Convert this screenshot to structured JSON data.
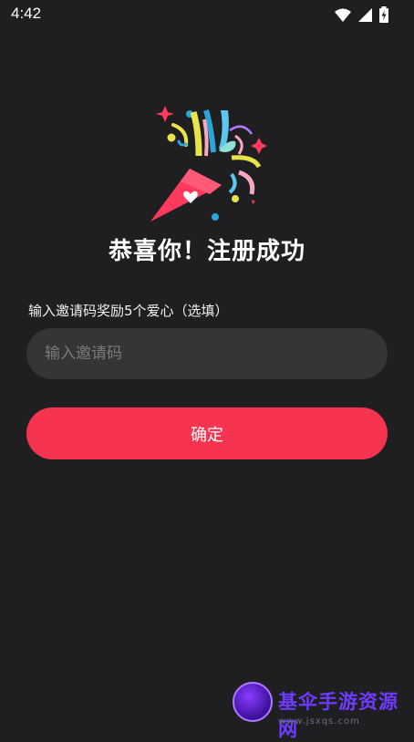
{
  "status_bar": {
    "time": "4:42",
    "icons": [
      "wifi-icon",
      "signal-icon",
      "battery-charging-icon"
    ]
  },
  "illustration": {
    "name": "party-popper-icon"
  },
  "title": "恭喜你！注册成功",
  "invite": {
    "label": "输入邀请码奖励5个爱心（选填）",
    "placeholder": "输入邀请码",
    "value": ""
  },
  "confirm_label": "确定",
  "watermark": {
    "text": "基伞手游资源网",
    "url": "www.jsxqs.com"
  },
  "colors": {
    "background": "#1f1f21",
    "accent": "#f7344f",
    "input_bg": "#353538"
  }
}
